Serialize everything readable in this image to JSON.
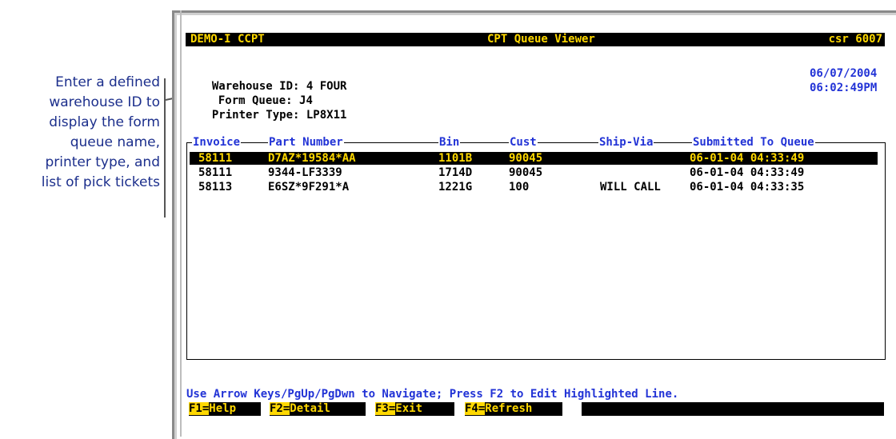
{
  "callout": {
    "lines": [
      "Enter a defined",
      "warehouse ID to",
      "display the form",
      "queue name,",
      "printer type, and",
      "list of pick tickets"
    ]
  },
  "titlebar": {
    "left": "DEMO-I CCPT",
    "center": "CPT Queue Viewer",
    "right": "csr 6007"
  },
  "header": {
    "warehouse_label": "Warehouse ID:",
    "warehouse_value": "4 FOUR",
    "form_queue_label": "Form Queue:",
    "form_queue_value": "J4",
    "printer_label": "Printer Type:",
    "printer_value": "LP8X11",
    "date": "06/07/2004",
    "time": "06:02:49PM"
  },
  "columns": {
    "invoice": "Invoice",
    "part": "Part Number",
    "bin": "Bin",
    "cust": "Cust",
    "shipvia": "Ship-Via",
    "submitted": "Submitted To Queue"
  },
  "rows": [
    {
      "invoice": "58111",
      "part": "D7AZ*19584*AA",
      "bin": "1101B",
      "cust": "90045",
      "shipvia": "",
      "submitted": "06-01-04 04:33:49"
    },
    {
      "invoice": "58111",
      "part": "9344-LF3339",
      "bin": "1714D",
      "cust": "90045",
      "shipvia": "",
      "submitted": "06-01-04 04:33:49"
    },
    {
      "invoice": "58113",
      "part": "E6SZ*9F291*A",
      "bin": "1221G",
      "cust": "100",
      "shipvia": "WILL CALL",
      "submitted": "06-01-04 04:33:35"
    }
  ],
  "hint": "Use Arrow Keys/PgUp/PgDwn to Navigate; Press F2 to Edit Highlighted Line.",
  "fkeys": [
    {
      "key": "F1=",
      "label": "Help"
    },
    {
      "key": "F2=",
      "label": "Detail"
    },
    {
      "key": "F3=",
      "label": "Exit"
    },
    {
      "key": "F4=",
      "label": "Refresh"
    }
  ],
  "colors": {
    "accent": "#2233d6",
    "highlight": "#ffd800",
    "bar": "#000000"
  }
}
